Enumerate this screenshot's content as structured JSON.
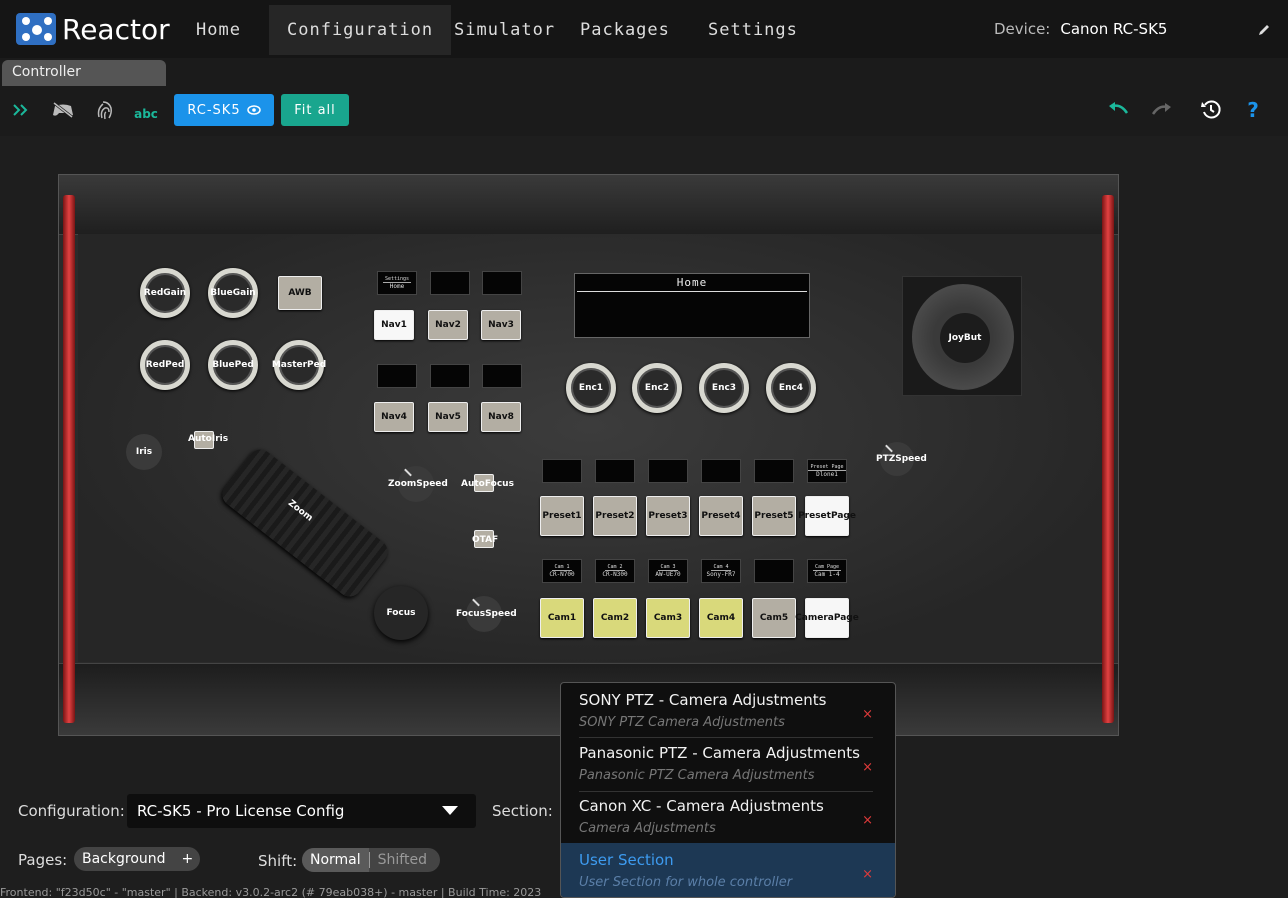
{
  "app": {
    "name": "Reactor"
  },
  "nav": {
    "items": [
      "Home",
      "Configuration",
      "Simulator",
      "Packages",
      "Settings"
    ],
    "active": "Configuration"
  },
  "device": {
    "label": "Device:",
    "value": "Canon RC-SK5"
  },
  "tabs": {
    "active": "Controller"
  },
  "toolbar": {
    "text_icon": "abc",
    "model_button": "RC-SK5",
    "fit_button": "Fit all"
  },
  "controller": {
    "knobs": {
      "redgain": "RedGain",
      "bluegain": "BlueGain",
      "redped": "RedPed",
      "blueped": "BluePed",
      "masterped": "MasterPed",
      "iris": "Iris",
      "focus": "Focus"
    },
    "awb": "AWB",
    "autoiris": "AutoIris",
    "autofocus": "AutoFocus",
    "otaf": "OTAF",
    "zoom": "Zoom",
    "zoomspeed": "ZoomSpeed",
    "focusspeed": "FocusSpeed",
    "ptzspeed": "PTZSpeed",
    "joybut": "JoyBut",
    "nav_buttons": [
      "Nav1",
      "Nav2",
      "Nav3",
      "Nav4",
      "Nav5",
      "Nav8"
    ],
    "nav_display": {
      "header": "Settings",
      "value": "Home"
    },
    "lcd_title": "Home",
    "encoders": [
      "Enc1",
      "Enc2",
      "Enc3",
      "Enc4"
    ],
    "presets": [
      "Preset1",
      "Preset2",
      "Preset3",
      "Preset4",
      "Preset5",
      "PresetPage"
    ],
    "preset_display": {
      "header": "Preset Page",
      "value": "Dlone1"
    },
    "cams": [
      "Cam1",
      "Cam2",
      "Cam3",
      "Cam4",
      "Cam5",
      "CameraPage"
    ],
    "cam_displays": [
      {
        "header": "Cam 1",
        "value": "CR-N700"
      },
      {
        "header": "Cam 2",
        "value": "CR-N300"
      },
      {
        "header": "Cam 3",
        "value": "AW-UE70"
      },
      {
        "header": "Cam 4",
        "value": "Sony-FR7"
      }
    ],
    "cam_page_display": {
      "header": "Cam Page",
      "value": "Cam 1-4"
    }
  },
  "form": {
    "configuration_label": "Configuration:",
    "configuration_value": "RC-SK5 - Pro License Config",
    "section_label": "Section:",
    "pages_label": "Pages:",
    "pages_value": "Background",
    "pages_add": "+",
    "shift_label": "Shift:",
    "shift_normal": "Normal",
    "shift_shifted": "Shifted"
  },
  "section_dropdown": {
    "items": [
      {
        "title": "SONY PTZ - Camera Adjustments",
        "subtitle": "SONY PTZ Camera Adjustments"
      },
      {
        "title": "Panasonic PTZ - Camera Adjustments",
        "subtitle": "Panasonic PTZ Camera Adjustments"
      },
      {
        "title": "Canon XC - Camera Adjustments",
        "subtitle": "Camera Adjustments"
      },
      {
        "title": "User Section",
        "subtitle": "User Section for whole controller"
      }
    ],
    "selected": "User Section",
    "remove_glyph": "×"
  },
  "footer": {
    "text": "Frontend: \"f23d50c\" - \"master\" | Backend: v3.0.2-arc2 (# 79eab038+) - master | Build Time: 2023"
  },
  "colors": {
    "accent_blue": "#1b93ea",
    "accent_green": "#19a68e",
    "toolbar_icon": "#1bb89b",
    "rail_red": "#e24242",
    "selection": "#1d3854",
    "remove": "#e03a3a"
  }
}
